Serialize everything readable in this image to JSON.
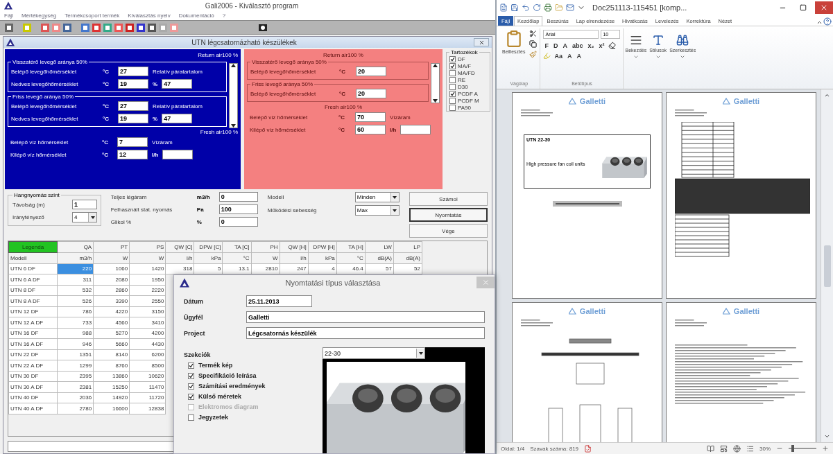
{
  "app": {
    "title": "Gali2006 - Kiválasztó program",
    "menu": [
      "Fájl",
      "Mértékegység",
      "Termékcsoport termék",
      "Kiválasztás nyelv",
      "Dokumentáció",
      "?"
    ],
    "child_title": "UTN légcsatornázható készülékek",
    "blue_panel": {
      "return_header": "Return air100 %",
      "groups": [
        {
          "title": "Visszatérő levegő aránya 50%",
          "rows": [
            {
              "label": "Belépő levegőhőmérséklet",
              "unit": "°C",
              "value": "27",
              "side_label": "Relatív páratartalom"
            },
            {
              "label": "Nedves levegőhőmérséklet",
              "unit": "°C",
              "value": "19",
              "side_unit": "%",
              "side_value": "47"
            }
          ]
        },
        {
          "title": "Friss levegő aránya 50%",
          "rows": [
            {
              "label": "Belépő levegőhőmérséklet",
              "unit": "°C",
              "value": "27",
              "side_label": "Relatív páratartalom"
            },
            {
              "label": "Nedves levegőhőmérséklet",
              "unit": "°C",
              "value": "19",
              "side_unit": "%",
              "side_value": "47"
            }
          ]
        }
      ],
      "fresh_header": "Fresh air100 %",
      "water": [
        {
          "label": "Belépő víz hőmérséklet",
          "unit": "°C",
          "value": "7",
          "side_label": "Vízáram"
        },
        {
          "label": "Kilépő víz hőmérséklet",
          "unit": "°C",
          "value": "12",
          "side_unit": "l/h"
        }
      ]
    },
    "red_panel": {
      "return_header": "Return air100 %",
      "groups": [
        {
          "title": "Visszatérő levegő aránya 50%",
          "rows": [
            {
              "label": "Belépő levegőhőmérséklet",
              "unit": "°C",
              "value": "20"
            }
          ]
        },
        {
          "title": "Friss levegő aránya 50%",
          "rows": [
            {
              "label": "Belépő levegőhőmérséklet",
              "unit": "°C",
              "value": "20"
            }
          ]
        }
      ],
      "fresh_header": "Fresh air100 %",
      "water": [
        {
          "label": "Belépő víz hőmérséklet",
          "unit": "°C",
          "value": "70",
          "side_label": "Vízáram"
        },
        {
          "label": "Kilépő víz hőmérséklet",
          "unit": "°C",
          "value": "60",
          "side_unit": "l/h"
        }
      ]
    },
    "accessories": {
      "title": "Tartozékok",
      "items": [
        {
          "label": "DF",
          "checked": true
        },
        {
          "label": "MA/F",
          "checked": true
        },
        {
          "label": "MA/FD",
          "checked": false
        },
        {
          "label": "RE",
          "checked": false
        },
        {
          "label": "D30",
          "checked": false
        },
        {
          "label": "PCDF A",
          "checked": true
        },
        {
          "label": "PCDF M",
          "checked": false
        },
        {
          "label": "PA90",
          "checked": false
        }
      ]
    },
    "sound": {
      "title": "Hangnyomás szint",
      "fields": [
        {
          "label": "Távolság (m)",
          "value": "1",
          "kind": "text"
        },
        {
          "label": "Iránytényező",
          "value": "4",
          "kind": "select"
        }
      ]
    },
    "flow_fields": [
      {
        "label": "Teljes légáram",
        "unit": "m3/h",
        "value": "0"
      },
      {
        "label": "Felhasznált stat. nyomás",
        "unit": "Pa",
        "value": "100"
      },
      {
        "label": "Glikol %",
        "unit": "%",
        "value": "0"
      }
    ],
    "selects": [
      {
        "label": "Modell",
        "value": "Minden"
      },
      {
        "label": "Működési sebesség",
        "value": "Max"
      }
    ],
    "buttons": [
      {
        "label": "Számol",
        "focused": false
      },
      {
        "label": "Nyomtatás",
        "focused": true
      },
      {
        "label": "Vége",
        "focused": false
      }
    ],
    "table": {
      "legend": "Legenda",
      "columns": [
        "QA",
        "PT",
        "PS",
        "QW [C]",
        "DPW [C]",
        "TA [C]",
        "PH",
        "QW [H]",
        "DPW [H]",
        "TA [H]",
        "LW",
        "LP"
      ],
      "units": [
        "Modell",
        "m3/h",
        "W",
        "W",
        "l/h",
        "kPa",
        "°C",
        "W",
        "l/h",
        "kPa",
        "°C",
        "dB(A)",
        "dB(A)"
      ],
      "rows": [
        {
          "model": "UTN 6 DF",
          "values": [
            "220",
            "1060",
            "1420",
            "318",
            "5",
            "13.1",
            "2810",
            "247",
            "4",
            "46.4",
            "57",
            "52"
          ],
          "selected": true
        },
        {
          "model": "UTN 6 A DF",
          "values": [
            "311",
            "2080",
            "1950"
          ],
          "selected": false
        },
        {
          "model": "UTN 8 DF",
          "values": [
            "532",
            "2860",
            "2220"
          ],
          "selected": false
        },
        {
          "model": "UTN 8 A DF",
          "values": [
            "526",
            "3390",
            "2550"
          ],
          "selected": false
        },
        {
          "model": "UTN 12 DF",
          "values": [
            "786",
            "4220",
            "3150"
          ],
          "selected": false
        },
        {
          "model": "UTN 12 A DF",
          "values": [
            "733",
            "4560",
            "3410"
          ],
          "selected": false
        },
        {
          "model": "UTN 16 DF",
          "values": [
            "988",
            "5270",
            "4200"
          ],
          "selected": false
        },
        {
          "model": "UTN 16 A DF",
          "values": [
            "946",
            "5660",
            "4430"
          ],
          "selected": false
        },
        {
          "model": "UTN 22 DF",
          "values": [
            "1351",
            "8140",
            "6200"
          ],
          "selected": false
        },
        {
          "model": "UTN 22 A DF",
          "values": [
            "1299",
            "8760",
            "8500"
          ],
          "selected": false
        },
        {
          "model": "UTN 30 DF",
          "values": [
            "2395",
            "13860",
            "10620"
          ],
          "selected": false
        },
        {
          "model": "UTN 30 A DF",
          "values": [
            "2381",
            "15250",
            "11470"
          ],
          "selected": false
        },
        {
          "model": "UTN 40 DF",
          "values": [
            "2036",
            "14920",
            "11720"
          ],
          "selected": false
        },
        {
          "model": "UTN 40 A DF",
          "values": [
            "2780",
            "16600",
            "12838"
          ],
          "selected": false
        }
      ]
    },
    "dialog": {
      "title": "Nyomtatási típus választása",
      "fields": [
        {
          "label": "Dátum",
          "value": "25.11.2013"
        },
        {
          "label": "Ügyfél",
          "value": "Galletti"
        },
        {
          "label": "Project",
          "value": "Légcsatornás készülék"
        }
      ],
      "sections_title": "Szekciók",
      "sections": [
        {
          "label": "Termék kép",
          "checked": true,
          "disabled": false
        },
        {
          "label": "Specifikáció leírása",
          "checked": true,
          "disabled": false
        },
        {
          "label": "Számítási eredmények",
          "checked": true,
          "disabled": false
        },
        {
          "label": "Külső méretek",
          "checked": true,
          "disabled": false
        },
        {
          "label": "Elektromos diagram",
          "checked": false,
          "disabled": true
        },
        {
          "label": "Jegyzetek",
          "checked": false,
          "disabled": false
        }
      ],
      "size_select": "22-30"
    }
  },
  "word": {
    "title": "Doc251113-115451 [komp...",
    "tabs": [
      {
        "label": "Fájl",
        "kind": "file",
        "selected": false
      },
      {
        "label": "Kezdőlap",
        "kind": "tab",
        "selected": true
      },
      {
        "label": "Beszúrás",
        "kind": "tab",
        "selected": false
      },
      {
        "label": "Lap elrendezése",
        "kind": "tab",
        "selected": false
      },
      {
        "label": "Hivatkozás",
        "kind": "tab",
        "selected": false
      },
      {
        "label": "Levelezés",
        "kind": "tab",
        "selected": false
      },
      {
        "label": "Korrektúra",
        "kind": "tab",
        "selected": false
      },
      {
        "label": "Nézet",
        "kind": "tab",
        "selected": false
      }
    ],
    "clipboard": {
      "paste": "Beillesztés",
      "group": "Vágólap"
    },
    "font": {
      "name": "Arial",
      "size": "10",
      "row1": [
        "F",
        "D",
        "A",
        "abc",
        "x₂",
        "x²"
      ],
      "row2": [
        "Aa",
        "A",
        "A"
      ],
      "group": "Betűtípus"
    },
    "big_buttons": [
      "Bekezdés",
      "Stílusok",
      "Szerkesztés"
    ],
    "pages": [
      {
        "kind": "cover",
        "logo": "Galletti",
        "heading": "UTN 22-30",
        "subtitle": "High pressure fan coil units"
      },
      {
        "kind": "tables",
        "logo": "Galletti"
      },
      {
        "kind": "drawing",
        "logo": "Galletti"
      },
      {
        "kind": "text",
        "logo": "Galletti"
      }
    ],
    "status": {
      "page": "Oldal: 1/4",
      "words": "Szavak száma: 819",
      "zoom": "30%",
      "zoom_slider": {
        "level": 0.15
      }
    }
  }
}
